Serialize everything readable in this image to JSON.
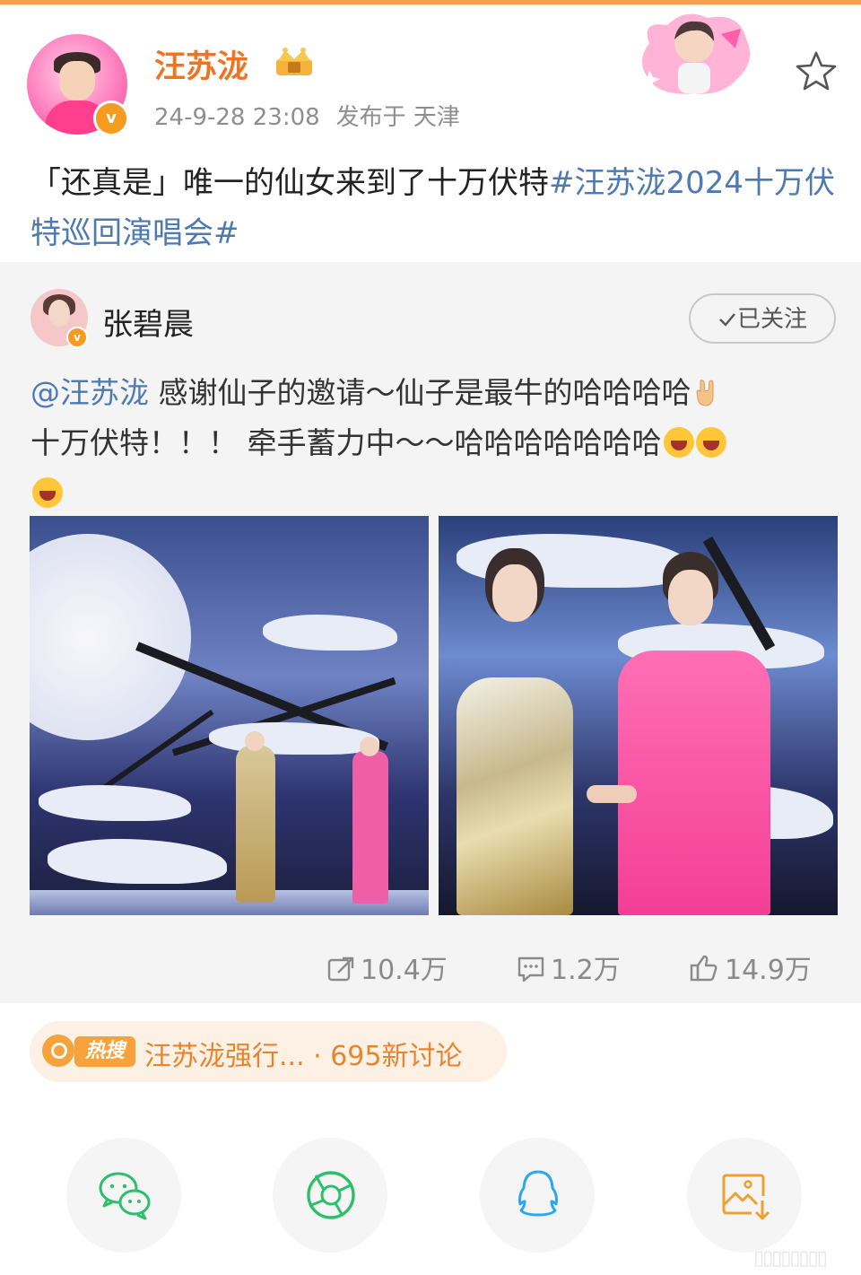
{
  "post": {
    "author": "汪苏泷",
    "time": "24-9-28 23:08",
    "location": "发布于 天津",
    "text_plain": "「还真是」唯一的仙女来到了十万伏特",
    "text_tag": "#汪苏泷2024十万伏特巡回演唱会#"
  },
  "repost": {
    "author": "张碧晨",
    "follow_label": "已关注",
    "mention": "@汪苏泷",
    "text_line1": " 感谢仙子的邀请～仙子是最牛的哈哈哈哈",
    "text_line2": "十万伏特！！！ 牵手蓄力中～～哈哈哈哈哈哈哈",
    "stats": {
      "reposts": "10.4万",
      "comments": "1.2万",
      "likes": "14.9万"
    }
  },
  "hot_search": {
    "badge": "热搜",
    "text": "汪苏泷强行... · 695新讨论"
  },
  "share": {
    "icons": [
      "wechat-icon",
      "moments-icon",
      "qq-icon",
      "save-image-icon"
    ]
  },
  "colors": {
    "author_name": "#f0731f",
    "link": "#4d7ab3",
    "hot_accent": "#f7a23a",
    "wechat": "#2dbf6c",
    "qq": "#29a8f0"
  }
}
